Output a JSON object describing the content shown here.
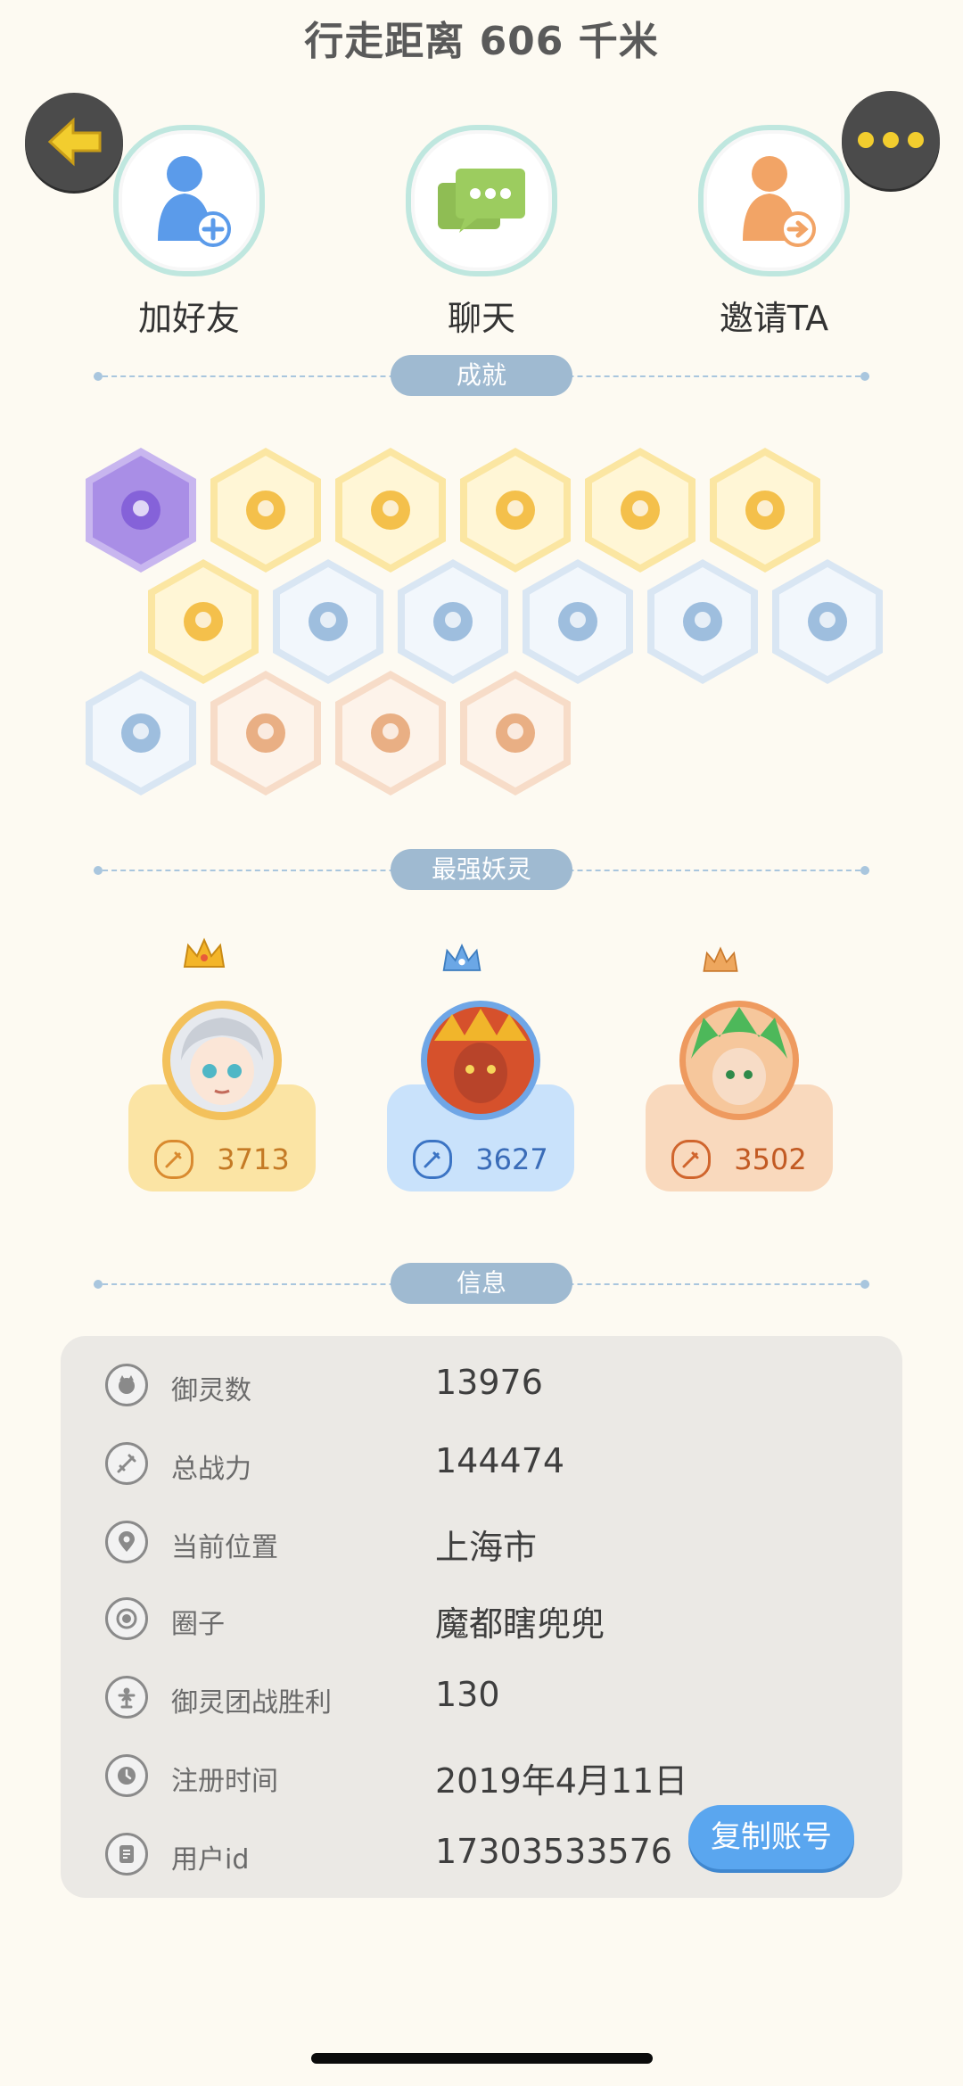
{
  "header": {
    "walk_distance": "行走距离 606 千米"
  },
  "actions": {
    "add_friend": "加好友",
    "chat": "聊天",
    "invite": "邀请TA"
  },
  "sections": {
    "achievements": "成就",
    "strongest_spirits": "最强妖灵",
    "info": "信息"
  },
  "achievements": {
    "row1": [
      "purple",
      "gold",
      "gold",
      "gold",
      "gold",
      "gold"
    ],
    "row2": [
      "gold",
      "blue",
      "blue",
      "blue",
      "blue",
      "blue"
    ],
    "row3": [
      "blue",
      "peach",
      "peach",
      "peach"
    ]
  },
  "spirits": [
    {
      "score": "3713",
      "theme": "#fbe4a4",
      "accent": "#d98a2f"
    },
    {
      "score": "3627",
      "theme": "#c9e2fb",
      "accent": "#3b74c4"
    },
    {
      "score": "3502",
      "theme": "#f9d9bd",
      "accent": "#d0652d"
    }
  ],
  "info": {
    "rows": [
      {
        "key": "御灵数",
        "value": "13976",
        "icon": "spirit-icon"
      },
      {
        "key": "总战力",
        "value": "144474",
        "icon": "sword-icon"
      },
      {
        "key": "当前位置",
        "value": "上海市",
        "icon": "location-pin-icon"
      },
      {
        "key": "圈子",
        "value": "魔都瞎兜兜",
        "icon": "circle-icon"
      },
      {
        "key": "御灵团战胜利",
        "value": "130",
        "icon": "trophy-icon"
      },
      {
        "key": "注册时间",
        "value": "2019年4月11日",
        "icon": "clock-icon"
      },
      {
        "key": "用户id",
        "value": "17303533576",
        "icon": "id-card-icon"
      }
    ],
    "copy_label": "复制账号"
  },
  "colors": {
    "background": "#fdfaf2",
    "divider_pill": "#9fbad1",
    "copy_button": "#5aa6ef",
    "gold": "#f2cd2e"
  }
}
